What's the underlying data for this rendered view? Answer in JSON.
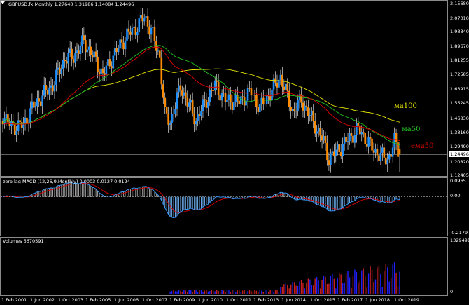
{
  "main": {
    "symbol_line": "GBPUSD.fx,Monthly  1.27640 1.31986 1.14084 1.24496",
    "price_label": "1.24496",
    "price_ticks": [
      "2.15680",
      "2.07010",
      "1.98340",
      "1.89670",
      "1.81255",
      "1.72585",
      "1.63915",
      "1.55245",
      "1.46830",
      "1.38160",
      "1.29490",
      "1.20820",
      "1.12405"
    ],
    "annotations": [
      {
        "id": "ma100",
        "text": "ма100",
        "color": "#e6e600"
      },
      {
        "id": "ma50",
        "text": "ма50",
        "color": "#22c322"
      },
      {
        "id": "ema50",
        "text": "ема50",
        "color": "#e00000"
      }
    ]
  },
  "macd": {
    "title": "zero lag MACD (12,26,9,Monthly) 0.0003 0.0127 0.0124",
    "ticks": [
      "0.0965",
      "0.00",
      "-0.2179"
    ]
  },
  "volume": {
    "title": "Volumes 5670591",
    "ticks": [
      "13294916",
      "0"
    ]
  },
  "x_ticks": [
    "1 Feb 2001",
    "1 Jun 2002",
    "1 Oct 2003",
    "1 Feb 2005",
    "1 Jun 2006",
    "1 Oct 2007",
    "1 Feb 2009",
    "1 Jun 2010",
    "1 Oct 2011",
    "1 Feb 2013",
    "1 Jun 2014",
    "1 Oct 2015",
    "1 Feb 2017",
    "1 Jun 2018",
    "1 Oct 2019"
  ],
  "colors": {
    "bull": "#1e90ff",
    "bear": "#ff8c00",
    "wick": "#ffffff",
    "ema50": "#e00000",
    "ma50": "#22c322",
    "ma100": "#e6e600",
    "macd_line": "#3399ff",
    "signal_line": "#e00000",
    "vol_blue": "#2020ff",
    "vol_red": "#c82020"
  },
  "chart_data": {
    "type": "candlestick",
    "timeframe": "Monthly",
    "symbol": "GBPUSD.fx",
    "ohlc_last": {
      "open": 1.2764,
      "high": 1.31986,
      "low": 1.14084,
      "close": 1.24496
    },
    "ylim": [
      1.12405,
      2.1568
    ],
    "close_series_approx": [
      {
        "date": "2001-01",
        "close": 1.48
      },
      {
        "date": "2001-06",
        "close": 1.41
      },
      {
        "date": "2002-01",
        "close": 1.42
      },
      {
        "date": "2002-06",
        "close": 1.52
      },
      {
        "date": "2003-01",
        "close": 1.61
      },
      {
        "date": "2003-06",
        "close": 1.66
      },
      {
        "date": "2004-01",
        "close": 1.82
      },
      {
        "date": "2004-06",
        "close": 1.83
      },
      {
        "date": "2004-12",
        "close": 1.92
      },
      {
        "date": "2005-06",
        "close": 1.82
      },
      {
        "date": "2005-11",
        "close": 1.72
      },
      {
        "date": "2006-06",
        "close": 1.85
      },
      {
        "date": "2007-01",
        "close": 1.96
      },
      {
        "date": "2007-06",
        "close": 2.0
      },
      {
        "date": "2007-11",
        "close": 2.07
      },
      {
        "date": "2008-03",
        "close": 1.99
      },
      {
        "date": "2008-08",
        "close": 1.82
      },
      {
        "date": "2008-11",
        "close": 1.48
      },
      {
        "date": "2009-02",
        "close": 1.44
      },
      {
        "date": "2009-08",
        "close": 1.65
      },
      {
        "date": "2010-05",
        "close": 1.45
      },
      {
        "date": "2010-11",
        "close": 1.57
      },
      {
        "date": "2011-04",
        "close": 1.66
      },
      {
        "date": "2011-10",
        "close": 1.57
      },
      {
        "date": "2012-06",
        "close": 1.56
      },
      {
        "date": "2013-01",
        "close": 1.62
      },
      {
        "date": "2013-06",
        "close": 1.52
      },
      {
        "date": "2014-06",
        "close": 1.71
      },
      {
        "date": "2015-01",
        "close": 1.5
      },
      {
        "date": "2015-06",
        "close": 1.57
      },
      {
        "date": "2016-02",
        "close": 1.42
      },
      {
        "date": "2016-07",
        "close": 1.32
      },
      {
        "date": "2016-10",
        "close": 1.22
      },
      {
        "date": "2017-06",
        "close": 1.3
      },
      {
        "date": "2018-03",
        "close": 1.4
      },
      {
        "date": "2018-12",
        "close": 1.27
      },
      {
        "date": "2019-08",
        "close": 1.21
      },
      {
        "date": "2019-12",
        "close": 1.32
      },
      {
        "date": "2020-03",
        "close": 1.24
      }
    ],
    "macd_range": [
      -0.2179,
      0.0965
    ],
    "macd_last": {
      "zero_lag_macd": 0.0003,
      "signal": 0.0127,
      "histogram": 0.0124
    },
    "volume_max": 13294916,
    "volume_last": 5670591
  }
}
